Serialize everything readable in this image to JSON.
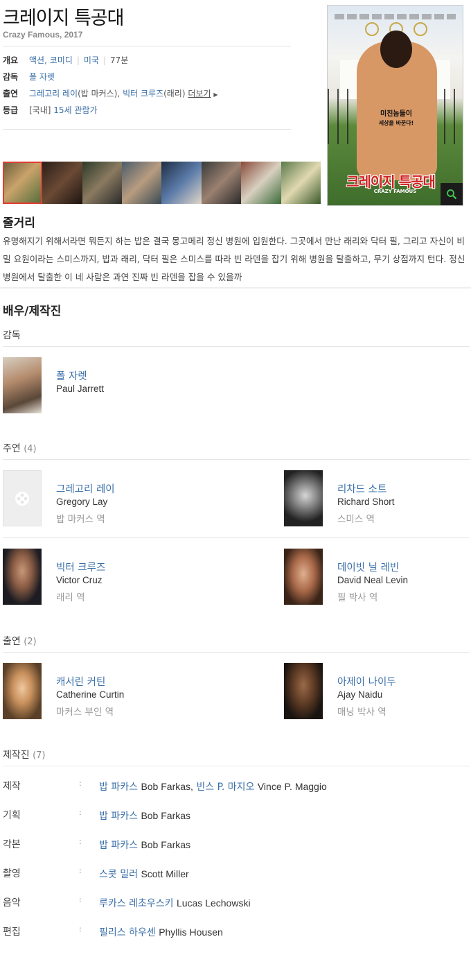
{
  "movie": {
    "title": "크레이지 특공대",
    "subtitle": "Crazy Famous, 2017"
  },
  "info": {
    "overview_label": "개요",
    "genre": "액션, 코미디",
    "country": "미국",
    "runtime": "77분",
    "director_label": "감독",
    "director": "폴 자렛",
    "cast_label": "출연",
    "cast_1": "그레고리 레이",
    "cast_1_role": "(밥 마커스)",
    "cast_sep": ",",
    "cast_2": "빅터 크루즈",
    "cast_2_role": "(래리)",
    "more": "더보기",
    "rating_label": "등급",
    "rating_region": "[국내]",
    "rating": "15세 관람가"
  },
  "poster": {
    "tagline_1": "미친놈들이",
    "tagline_2": "세상을 바꾼다!",
    "title": "크레이지 특공대",
    "title_en": "CRAZY FAMOUS"
  },
  "synopsis": {
    "heading": "줄거리",
    "text": "유명해지기 위해서라면 뭐든지 하는 밥은 결국 몽고메리 정신 병원에 입원한다. 그곳에서 만난 래리와 닥터 필, 그리고 자신이 비밀 요원이라는 스미스까지, 밥과 래리, 닥터 필은 스미스를 따라 빈 라덴을 잡기 위해 병원을 탈출하고, 무기 상점까지 턴다. 정신 병원에서 탈출한 이 네 사람은 과연 진짜 빈 라덴을 잡을 수 있을까"
  },
  "cast_crew": {
    "heading": "배우/제작진",
    "director_section": "감독",
    "director": {
      "name_ko": "폴 자렛",
      "name_en": "Paul Jarrett"
    },
    "lead_section": "주연",
    "lead_count": "(4)",
    "leads": [
      {
        "name_ko": "그레고리 레이",
        "name_en": "Gregory Lay",
        "role": "밥 마커스 역"
      },
      {
        "name_ko": "리차드 소트",
        "name_en": "Richard Short",
        "role": "스미스 역"
      },
      {
        "name_ko": "빅터 크루즈",
        "name_en": "Victor Cruz",
        "role": "래리 역"
      },
      {
        "name_ko": "데이빗 닐 레빈",
        "name_en": "David Neal Levin",
        "role": "필 박사 역"
      }
    ],
    "support_section": "출연",
    "support_count": "(2)",
    "support": [
      {
        "name_ko": "캐서린 커틴",
        "name_en": "Catherine Curtin",
        "role": "마커스 부인 역"
      },
      {
        "name_ko": "아제이 나이두",
        "name_en": "Ajay Naidu",
        "role": "매닝 박사 역"
      }
    ],
    "crew_section": "제작진",
    "crew_count": "(7)",
    "crew": [
      {
        "role": "제작",
        "colon": ":",
        "p1_ko": "밥 파카스",
        "p1_en": "Bob Farkas",
        "comma": ",",
        "p2_ko": "빈스 P. 마지오",
        "p2_en": "Vince P. Maggio"
      },
      {
        "role": "기획",
        "colon": ":",
        "p1_ko": "밥 파카스",
        "p1_en": "Bob Farkas"
      },
      {
        "role": "각본",
        "colon": ":",
        "p1_ko": "밥 파카스",
        "p1_en": "Bob Farkas"
      },
      {
        "role": "촬영",
        "colon": ":",
        "p1_ko": "스콧 밀러",
        "p1_en": "Scott Miller"
      },
      {
        "role": "음악",
        "colon": ":",
        "p1_ko": "루카스 레초우스키",
        "p1_en": "Lucas Lechowski"
      },
      {
        "role": "편집",
        "colon": ":",
        "p1_ko": "필리스 하우센",
        "p1_en": "Phyllis Housen"
      }
    ]
  },
  "colors": {
    "link": "#3a6fa8",
    "selected_still": "#e03c31"
  }
}
